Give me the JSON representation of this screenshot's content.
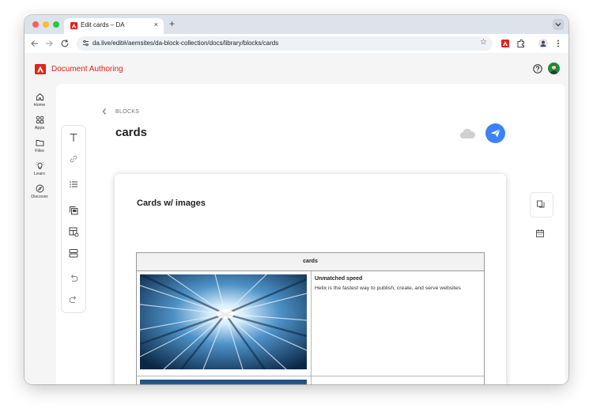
{
  "browser": {
    "tab_title": "Edit cards – DA",
    "tab_close": "×",
    "new_tab": "+",
    "url": "da.live/edit#/aemsites/da-block-collection/docs/library/blocks/cards",
    "bookmark_glyph": "☆"
  },
  "app": {
    "brand_name": "Document Authoring",
    "brand_color": "#e0231b",
    "accent_color": "#3b82f6"
  },
  "nav": {
    "items": [
      {
        "label": "Home",
        "icon": "home-icon"
      },
      {
        "label": "Apps",
        "icon": "apps-icon"
      },
      {
        "label": "Files",
        "icon": "folder-icon"
      },
      {
        "label": "Learn",
        "icon": "lightbulb-icon"
      },
      {
        "label": "Discover",
        "icon": "compass-icon"
      }
    ]
  },
  "editor": {
    "breadcrumb": "BLOCKS",
    "title": "cards",
    "tools": [
      "text-icon",
      "link-icon",
      "list-icon",
      "copy-block-icon",
      "table-add-icon",
      "section-icon",
      "undo-icon",
      "redo-icon"
    ],
    "side_tools": [
      "versions-icon",
      "calendar-icon"
    ]
  },
  "document": {
    "heading": "Cards w/ images",
    "block_name": "cards",
    "cards": [
      {
        "title": "Unmatched speed",
        "description": "Helix is the fastest way to publish, create, and serve websites",
        "image": "speed-tunnel-image"
      },
      {
        "title": "",
        "description": "",
        "image": "blue-image"
      }
    ]
  }
}
